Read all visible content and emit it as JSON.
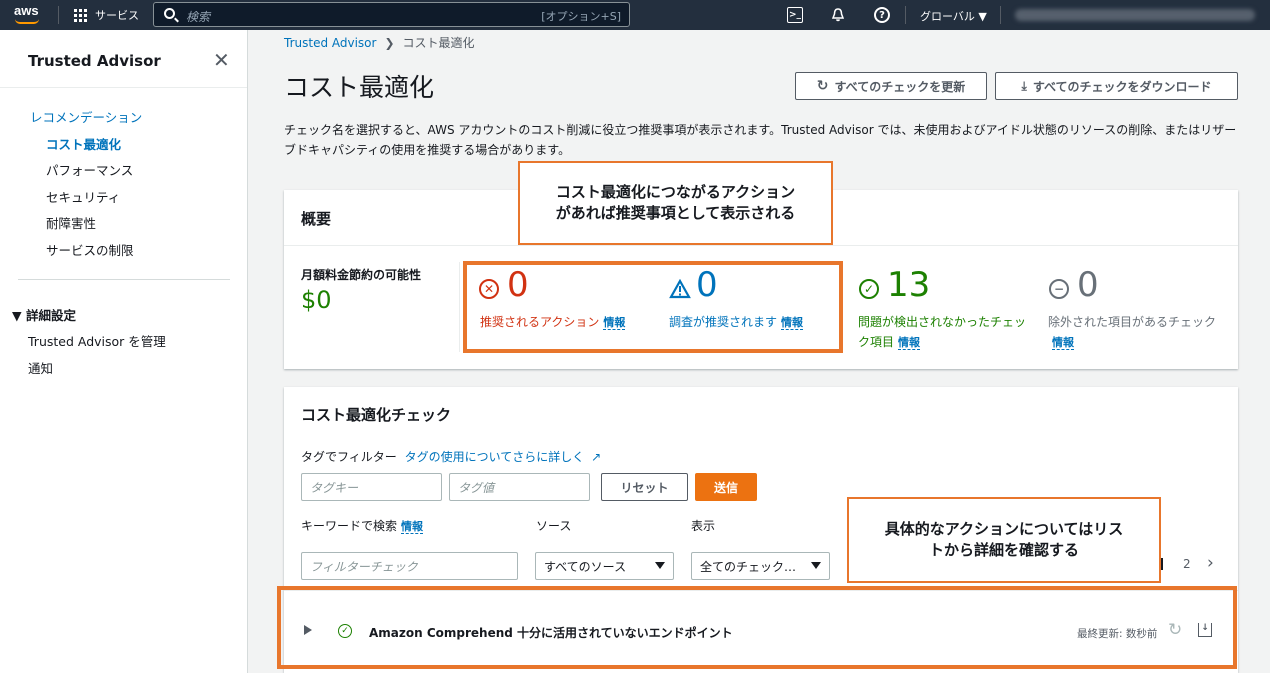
{
  "topbar": {
    "logo": "aws",
    "services": "サービス",
    "search_placeholder": "検索",
    "search_shortcut": "[オプション+S]",
    "region": "グローバル ▼"
  },
  "sidebar": {
    "title": "Trusted Advisor",
    "items": [
      {
        "label": "レコメンデーション"
      },
      {
        "label": "コスト最適化"
      },
      {
        "label": "パフォーマンス"
      },
      {
        "label": "セキュリティ"
      },
      {
        "label": "耐障害性"
      },
      {
        "label": "サービスの制限"
      }
    ],
    "section": "▼  詳細設定",
    "section_items": [
      {
        "label": "Trusted Advisor を管理"
      },
      {
        "label": "通知"
      }
    ]
  },
  "breadcrumb": {
    "root": "Trusted Advisor",
    "current": "コスト最適化"
  },
  "page": {
    "title": "コスト最適化",
    "refresh_all": "すべてのチェックを更新",
    "download_all": "すべてのチェックをダウンロード",
    "description": "チェック名を選択すると、AWS アカウントのコスト削減に役立つ推奨事項が表示されます。Trusted Advisor では、未使用およびアイドル状態のリソースの削除、またはリザーブドキャパシティの使用を推奨する場合があります。"
  },
  "overview": {
    "title": "概要",
    "savings_label": "月額料金節約の可能性",
    "savings_value": "$0",
    "info": "情報",
    "stats": [
      {
        "count": "0",
        "label": "推奨されるアクション",
        "color": "#d13212"
      },
      {
        "count": "0",
        "label": "調査が推奨されます",
        "color": "#0073bb"
      },
      {
        "count": "13",
        "label": "問題が検出されなかったチェック項目",
        "color": "#1d8102"
      },
      {
        "count": "0",
        "label": "除外された項目があるチェック",
        "color": "#687078"
      }
    ]
  },
  "checks": {
    "title": "コスト最適化チェック",
    "tag_filter": "タグでフィルター",
    "tag_link": "タグの使用についてさらに詳しく",
    "tag_key_ph": "タグキー",
    "tag_value_ph": "タグ値",
    "reset": "リセット",
    "submit": "送信",
    "keyword_label": "キーワードで検索",
    "keyword_ph": "フィルターチェック",
    "source_label": "ソース",
    "source_value": "すべてのソース",
    "display_label": "表示",
    "display_value": "全てのチェック…",
    "page_num": "2",
    "row_title": "Amazon Comprehend 十分に活用されていないエンドポイント",
    "row_updated": "最終更新: 数秒前"
  },
  "callouts": {
    "top": "コスト最適化につながるアクション\nがあれば推奨事項として表示される",
    "bottom": "具体的なアクションについてはリス\nトから詳細を確認する"
  },
  "colors": {
    "accent": "#e8762c",
    "primary_button": "#ec7211",
    "link": "#0073bb"
  }
}
